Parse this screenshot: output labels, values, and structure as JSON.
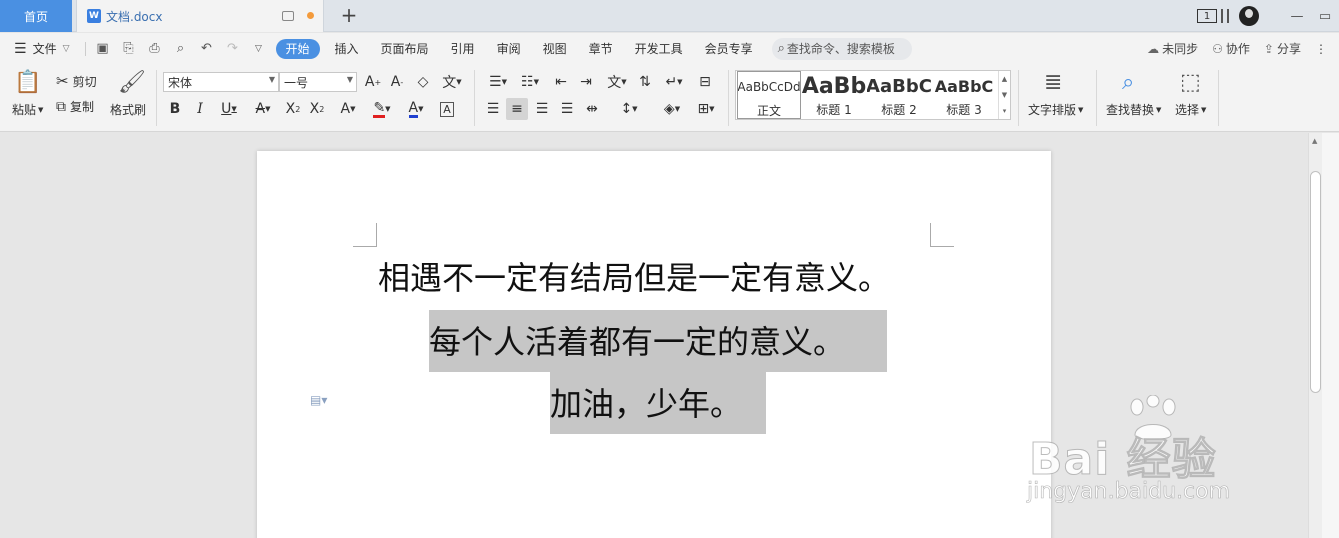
{
  "tabs": {
    "home": "首页",
    "doc": "文档.docx",
    "page_count": "1"
  },
  "menu": {
    "file": "文件",
    "items": [
      "开始",
      "插入",
      "页面布局",
      "引用",
      "审阅",
      "视图",
      "章节",
      "开发工具",
      "会员专享"
    ],
    "search_placeholder": "查找命令、搜索模板",
    "right": [
      "未同步",
      "协作",
      "分享"
    ]
  },
  "ribbon": {
    "paste": "粘贴",
    "cut": "剪切",
    "copy": "复制",
    "format_painter": "格式刷",
    "font_name": "宋体",
    "font_size": "一号",
    "styles": [
      {
        "preview": "AaBbCcDd",
        "label": "正文"
      },
      {
        "preview": "AaBb",
        "label": "标题 1"
      },
      {
        "preview": "AaBbC",
        "label": "标题 2"
      },
      {
        "preview": "AaBbC",
        "label": "标题 3"
      }
    ],
    "text_layout": "文字排版",
    "find_replace": "查找替换",
    "select": "选择"
  },
  "document": {
    "lines": [
      "相遇不一定有结局但是一定有意义。",
      "每个人活着都有一定的意义。",
      "加油，少年。"
    ]
  },
  "watermark": {
    "brand": "Bai  经验",
    "url": "jingyan.baidu.com"
  },
  "colors": {
    "accent": "#4a90e2",
    "highlight": "#c6c6c6",
    "font_color_red": "#e02020",
    "font_color_blue": "#2040d0"
  }
}
